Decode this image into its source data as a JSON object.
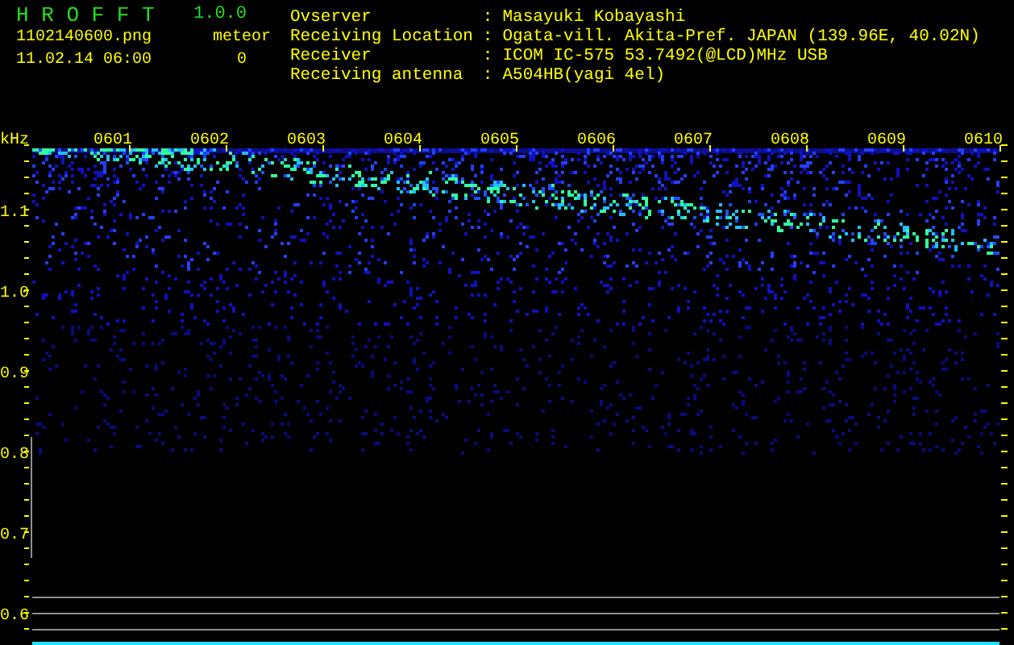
{
  "app": {
    "name": "H R O F F T",
    "version": "1.0.0"
  },
  "file": {
    "name": "1102140600.png",
    "timestamp": "11.02.14 06:00"
  },
  "meteor": {
    "label": "meteor",
    "count": "0"
  },
  "station": [
    {
      "label": "Ovserver",
      "separator": ":",
      "value": "Masayuki Kobayashi"
    },
    {
      "label": "Receiving Location",
      "separator": ":",
      "value": "Ogata-vill. Akita-Pref. JAPAN (139.96E, 40.02N)"
    },
    {
      "label": "Receiver",
      "separator": ":",
      "value": "ICOM IC-575 53.7492(@LCD)MHz USB"
    },
    {
      "label": "Receiving antenna",
      "separator": ":",
      "value": "A504HB(yagi 4el)"
    }
  ],
  "spectrogram": {
    "unit": "kHz",
    "freq_labels": [
      "1.1",
      "1.0",
      "0.9",
      "0.8",
      "0.7",
      "0.6"
    ],
    "time_labels": [
      "0601",
      "0602",
      "0603",
      "0604",
      "0605",
      "0606",
      "0607",
      "0608",
      "0609",
      "0610"
    ]
  }
}
